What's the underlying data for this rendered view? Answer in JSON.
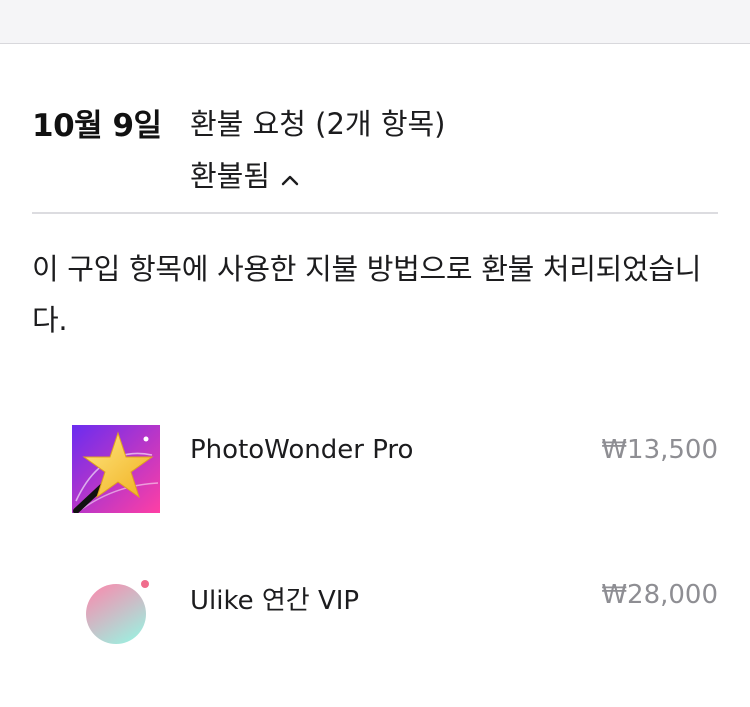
{
  "refund": {
    "date": "10월 9일",
    "title": "환불 요청 (2개 항목)",
    "status": "환불됨",
    "message": "이 구입 항목에 사용한 지불 방법으로 환불 처리되었습니다."
  },
  "items": [
    {
      "name": "PhotoWonder Pro",
      "price": "₩13,500",
      "icon": "star-wand-icon"
    },
    {
      "name": "Ulike 연간 VIP",
      "price": "₩28,000",
      "icon": "gradient-circle-icon"
    }
  ],
  "colors": {
    "text": "#1c1c1e",
    "secondary_text": "#8e8e93",
    "divider": "#dcdce0",
    "photowonder_gradient_start": "#6a2cf0",
    "photowonder_gradient_end": "#ff3fa4",
    "ulike_gradient_start": "#f58fb0",
    "ulike_gradient_end": "#9cf0e0"
  }
}
